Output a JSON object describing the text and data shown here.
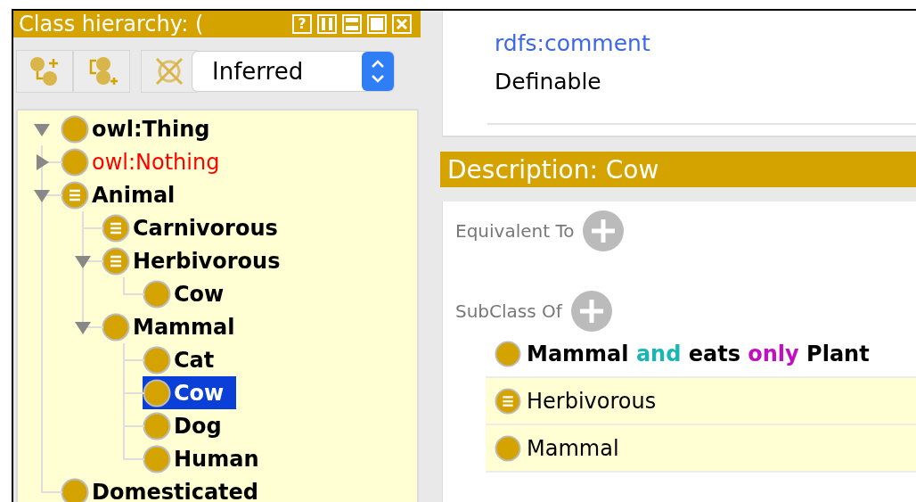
{
  "class_hierarchy": {
    "title": "Class hierarchy: (",
    "help_button": "?",
    "view_mode": "Inferred",
    "tree": [
      {
        "label": "owl:Thing",
        "kind": "primitive",
        "unsatisfiable": false,
        "expanded": true,
        "selected": false,
        "children": [
          {
            "label": "owl:Nothing",
            "kind": "primitive",
            "unsatisfiable": true,
            "expanded": false,
            "selected": false
          },
          {
            "label": "Animal",
            "kind": "defined",
            "unsatisfiable": false,
            "expanded": true,
            "selected": false,
            "children": [
              {
                "label": "Carnivorous",
                "kind": "defined",
                "unsatisfiable": false,
                "selected": false
              },
              {
                "label": "Herbivorous",
                "kind": "defined",
                "unsatisfiable": false,
                "expanded": true,
                "selected": false,
                "children": [
                  {
                    "label": "Cow",
                    "kind": "primitive",
                    "unsatisfiable": false,
                    "selected": false
                  }
                ]
              },
              {
                "label": "Mammal",
                "kind": "primitive",
                "unsatisfiable": false,
                "expanded": true,
                "selected": false,
                "children": [
                  {
                    "label": "Cat",
                    "kind": "primitive",
                    "unsatisfiable": false,
                    "selected": false
                  },
                  {
                    "label": "Cow",
                    "kind": "primitive",
                    "unsatisfiable": false,
                    "selected": true
                  },
                  {
                    "label": "Dog",
                    "kind": "primitive",
                    "unsatisfiable": false,
                    "selected": false
                  },
                  {
                    "label": "Human",
                    "kind": "primitive",
                    "unsatisfiable": false,
                    "selected": false
                  }
                ]
              }
            ]
          },
          {
            "label": "Domesticated",
            "kind": "primitive",
            "unsatisfiable": false,
            "selected": false
          }
        ]
      }
    ]
  },
  "annotations": {
    "property": "rdfs:comment",
    "value": "Definable"
  },
  "description": {
    "title": "Description: Cow",
    "sections": [
      {
        "label": "Equivalent To"
      },
      {
        "label": "SubClass Of",
        "entries": [
          {
            "kind": "primitive",
            "inferred": false,
            "segments": [
              {
                "text": "Mammal",
                "kind": "class"
              },
              {
                "text": "and",
                "kind": "boolean"
              },
              {
                "text": "eats",
                "kind": "property"
              },
              {
                "text": "only",
                "kind": "restriction"
              },
              {
                "text": "Plant",
                "kind": "class"
              }
            ]
          },
          {
            "kind": "defined",
            "inferred": true,
            "label": "Herbivorous"
          },
          {
            "kind": "primitive",
            "inferred": true,
            "label": "Mammal"
          }
        ]
      }
    ]
  }
}
